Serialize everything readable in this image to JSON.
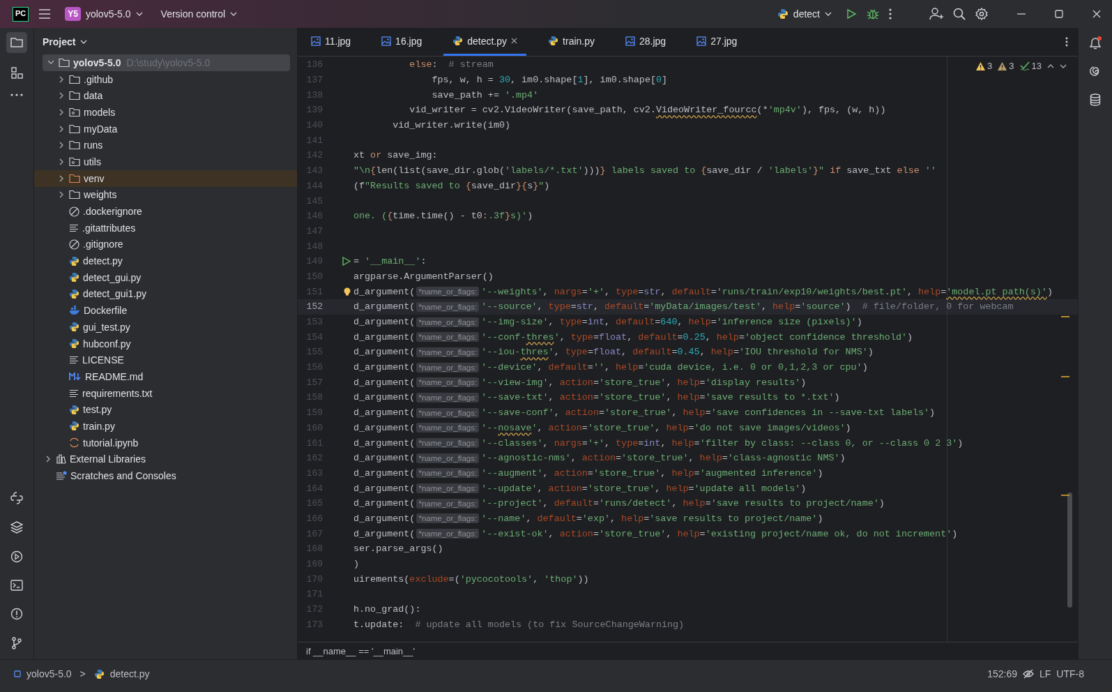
{
  "titlebar": {
    "logo": "PC",
    "project_badge": "Y5",
    "project": "yolov5-5.0",
    "vcs": "Version control",
    "run_config": "detect"
  },
  "project_panel": {
    "title": "Project",
    "tree": [
      {
        "name": "yolov5-5.0",
        "path": "D:\\study\\yolov5-5.0",
        "kind": "folder",
        "expanded": true,
        "selected": true,
        "children": [
          {
            "name": ".github",
            "kind": "folder",
            "expanded": false,
            "selected": false
          },
          {
            "name": "data",
            "kind": "folder",
            "expanded": false,
            "selected": false
          },
          {
            "name": "models",
            "kind": "package",
            "expanded": false,
            "selected": false
          },
          {
            "name": "myData",
            "kind": "folder",
            "expanded": false,
            "selected": false
          },
          {
            "name": "runs",
            "kind": "folder",
            "expanded": false,
            "selected": false
          },
          {
            "name": "utils",
            "kind": "package",
            "expanded": false,
            "selected": false
          },
          {
            "name": "venv",
            "kind": "excluded",
            "expanded": false,
            "selected": false
          },
          {
            "name": "weights",
            "kind": "folder",
            "expanded": false,
            "selected": false
          },
          {
            "name": ".dockerignore",
            "kind": "ignore",
            "selected": false
          },
          {
            "name": ".gitattributes",
            "kind": "text",
            "selected": false
          },
          {
            "name": ".gitignore",
            "kind": "ignore",
            "selected": false
          },
          {
            "name": "detect.py",
            "kind": "python",
            "selected": false
          },
          {
            "name": "detect_gui.py",
            "kind": "python",
            "selected": false
          },
          {
            "name": "detect_gui1.py",
            "kind": "python",
            "selected": false
          },
          {
            "name": "Dockerfile",
            "kind": "docker",
            "selected": false
          },
          {
            "name": "gui_test.py",
            "kind": "python",
            "selected": false
          },
          {
            "name": "hubconf.py",
            "kind": "python",
            "selected": false
          },
          {
            "name": "LICENSE",
            "kind": "text",
            "selected": false
          },
          {
            "name": "README.md",
            "kind": "markdown",
            "selected": false
          },
          {
            "name": "requirements.txt",
            "kind": "text",
            "selected": false
          },
          {
            "name": "test.py",
            "kind": "python",
            "selected": false
          },
          {
            "name": "train.py",
            "kind": "python",
            "selected": false
          },
          {
            "name": "tutorial.ipynb",
            "kind": "notebook",
            "selected": false
          }
        ]
      },
      {
        "name": "External Libraries",
        "kind": "library",
        "expanded": false,
        "selected": false
      },
      {
        "name": "Scratches and Consoles",
        "kind": "scratch",
        "selected": false
      }
    ]
  },
  "tabs": [
    {
      "label": "11.jpg",
      "kind": "image",
      "selected": false
    },
    {
      "label": "16.jpg",
      "kind": "image",
      "selected": false
    },
    {
      "label": "detect.py",
      "kind": "python",
      "selected": true
    },
    {
      "label": "train.py",
      "kind": "python",
      "selected": false
    },
    {
      "label": "28.jpg",
      "kind": "image",
      "selected": false
    },
    {
      "label": "27.jpg",
      "kind": "image",
      "selected": false
    }
  ],
  "inspections": [
    {
      "kind": "warning",
      "count": "3"
    },
    {
      "kind": "weak",
      "count": "3"
    },
    {
      "kind": "typo",
      "count": "13"
    }
  ],
  "code": {
    "lines": [
      {
        "number": "136",
        "current": false,
        "tokens": [
          {
            "kind": "k",
            "text": "          else"
          },
          {
            "kind": "t",
            "text": ":  "
          },
          {
            "kind": "c",
            "text": "# stream"
          }
        ]
      },
      {
        "number": "137",
        "current": false,
        "tokens": [
          {
            "kind": "t",
            "text": "              fps, w, h = "
          },
          {
            "kind": "n",
            "text": "30"
          },
          {
            "kind": "t",
            "text": ", im0.shape["
          },
          {
            "kind": "n",
            "text": "1"
          },
          {
            "kind": "t",
            "text": "], im0.shape["
          },
          {
            "kind": "n",
            "text": "0"
          },
          {
            "kind": "t",
            "text": "]"
          }
        ]
      },
      {
        "number": "138",
        "current": false,
        "tokens": [
          {
            "kind": "t",
            "text": "              save_path += "
          },
          {
            "kind": "s",
            "text": "'.mp4'"
          }
        ]
      },
      {
        "number": "139",
        "current": false,
        "tokens": [
          {
            "kind": "t",
            "text": "          vid_writer = cv2.VideoWriter(save_path, cv2."
          },
          {
            "kind": "w",
            "text": "VideoWriter_fourcc"
          },
          {
            "kind": "t",
            "text": "(*"
          },
          {
            "kind": "s",
            "text": "'mp4v'"
          },
          {
            "kind": "t",
            "text": "), fps, (w, h))"
          }
        ]
      },
      {
        "number": "140",
        "current": false,
        "tokens": [
          {
            "kind": "t",
            "text": "       vid_writer.write(im0)"
          }
        ]
      },
      {
        "number": "141",
        "current": false
      },
      {
        "number": "142",
        "current": false,
        "tokens": [
          {
            "kind": "t",
            "text": "xt "
          },
          {
            "kind": "k",
            "text": "or"
          },
          {
            "kind": "t",
            "text": " save_img:"
          }
        ]
      },
      {
        "number": "143",
        "current": false,
        "tokens": [
          {
            "kind": "s",
            "text": "\"\\n"
          },
          {
            "kind": "f",
            "text": "{"
          },
          {
            "kind": "t",
            "text": "len(list(save_dir.glob("
          },
          {
            "kind": "s",
            "text": "'labels/*.txt'"
          },
          {
            "kind": "t",
            "text": ")))"
          },
          {
            "kind": "f",
            "text": "}"
          },
          {
            "kind": "s",
            "text": " labels saved to "
          },
          {
            "kind": "f",
            "text": "{"
          },
          {
            "kind": "t",
            "text": "save_dir / "
          },
          {
            "kind": "s",
            "text": "'labels'"
          },
          {
            "kind": "f",
            "text": "}"
          },
          {
            "kind": "s",
            "text": "\" "
          },
          {
            "kind": "k",
            "text": "if"
          },
          {
            "kind": "t",
            "text": " save_txt "
          },
          {
            "kind": "k",
            "text": "else"
          },
          {
            "kind": "s",
            "text": " ''"
          }
        ]
      },
      {
        "number": "144",
        "current": false,
        "tokens": [
          {
            "kind": "t",
            "text": "(f"
          },
          {
            "kind": "s",
            "text": "\"Results saved to "
          },
          {
            "kind": "f",
            "text": "{"
          },
          {
            "kind": "t",
            "text": "save_dir"
          },
          {
            "kind": "f",
            "text": "}{"
          },
          {
            "kind": "t",
            "text": "s"
          },
          {
            "kind": "f",
            "text": "}"
          },
          {
            "kind": "s",
            "text": "\""
          },
          {
            "kind": "t",
            "text": ")"
          }
        ]
      },
      {
        "number": "145",
        "current": false
      },
      {
        "number": "146",
        "current": false,
        "tokens": [
          {
            "kind": "s",
            "text": "one. ("
          },
          {
            "kind": "f",
            "text": "{"
          },
          {
            "kind": "t",
            "text": "time.time() - t0"
          },
          {
            "kind": "f",
            "text": ":"
          },
          {
            "kind": "s",
            "text": ".3f"
          },
          {
            "kind": "f",
            "text": "}"
          },
          {
            "kind": "s",
            "text": "s)'"
          },
          {
            "kind": "t",
            "text": ")"
          }
        ]
      },
      {
        "number": "147",
        "current": false
      },
      {
        "number": "148",
        "current": false
      },
      {
        "number": "149",
        "current": false,
        "kind": "run",
        "tokens": [
          {
            "kind": "t",
            "text": "= "
          },
          {
            "kind": "s",
            "text": "'__main__'"
          },
          {
            "kind": "t",
            "text": ":"
          }
        ]
      },
      {
        "number": "150",
        "current": false,
        "tokens": [
          {
            "kind": "t",
            "text": "argparse.ArgumentParser()"
          }
        ]
      },
      {
        "number": "151",
        "current": false,
        "kind": "bulb",
        "tokens": [
          {
            "kind": "t",
            "text": "d_argument("
          },
          {
            "kind": "h",
            "text": "*name_or_flags:"
          },
          {
            "kind": "s",
            "text": "'--weights'"
          },
          {
            "kind": "t",
            "text": ", "
          },
          {
            "kind": "a",
            "text": "nargs"
          },
          {
            "kind": "t",
            "text": "="
          },
          {
            "kind": "s",
            "text": "'+'"
          },
          {
            "kind": "t",
            "text": ", "
          },
          {
            "kind": "a",
            "text": "type"
          },
          {
            "kind": "t",
            "text": "="
          },
          {
            "kind": "b",
            "text": "str"
          },
          {
            "kind": "t",
            "text": ", "
          },
          {
            "kind": "a",
            "text": "default"
          },
          {
            "kind": "t",
            "text": "="
          },
          {
            "kind": "s",
            "text": "'runs/train/exp10/weights/best.pt'"
          },
          {
            "kind": "t",
            "text": ", "
          },
          {
            "kind": "a",
            "text": "help"
          },
          {
            "kind": "t",
            "text": "="
          },
          {
            "kind": "x",
            "text": "'model.pt path(s)'"
          },
          {
            "kind": "t",
            "text": ")"
          }
        ]
      },
      {
        "number": "152",
        "current": true,
        "tokens": [
          {
            "kind": "t",
            "text": "d_argument("
          },
          {
            "kind": "h",
            "text": "*name_or_flags:"
          },
          {
            "kind": "s",
            "text": "'--source'"
          },
          {
            "kind": "t",
            "text": ", "
          },
          {
            "kind": "a",
            "text": "type"
          },
          {
            "kind": "t",
            "text": "="
          },
          {
            "kind": "b",
            "text": "str"
          },
          {
            "kind": "t",
            "text": ", "
          },
          {
            "kind": "a",
            "text": "default"
          },
          {
            "kind": "t",
            "text": "="
          },
          {
            "kind": "s",
            "text": "'myData/images/test'"
          },
          {
            "kind": "t",
            "text": ", "
          },
          {
            "kind": "a",
            "text": "help"
          },
          {
            "kind": "t",
            "text": "="
          },
          {
            "kind": "s",
            "text": "'source'"
          },
          {
            "kind": "t",
            "text": ")  "
          },
          {
            "kind": "c",
            "text": "# file/folder, 0 for webcam"
          }
        ]
      },
      {
        "number": "153",
        "current": false,
        "tokens": [
          {
            "kind": "t",
            "text": "d_argument("
          },
          {
            "kind": "h",
            "text": "*name_or_flags:"
          },
          {
            "kind": "s",
            "text": "'--img-size'"
          },
          {
            "kind": "t",
            "text": ", "
          },
          {
            "kind": "a",
            "text": "type"
          },
          {
            "kind": "t",
            "text": "="
          },
          {
            "kind": "b",
            "text": "int"
          },
          {
            "kind": "t",
            "text": ", "
          },
          {
            "kind": "a",
            "text": "default"
          },
          {
            "kind": "t",
            "text": "="
          },
          {
            "kind": "n",
            "text": "640"
          },
          {
            "kind": "t",
            "text": ", "
          },
          {
            "kind": "a",
            "text": "help"
          },
          {
            "kind": "t",
            "text": "="
          },
          {
            "kind": "s",
            "text": "'inference size (pixels)'"
          },
          {
            "kind": "t",
            "text": ")"
          }
        ]
      },
      {
        "number": "154",
        "current": false,
        "tokens": [
          {
            "kind": "t",
            "text": "d_argument("
          },
          {
            "kind": "h",
            "text": "*name_or_flags:"
          },
          {
            "kind": "s",
            "text": "'--conf-"
          },
          {
            "kind": "x",
            "text": "thres"
          },
          {
            "kind": "s",
            "text": "'"
          },
          {
            "kind": "t",
            "text": ", "
          },
          {
            "kind": "a",
            "text": "type"
          },
          {
            "kind": "t",
            "text": "="
          },
          {
            "kind": "b",
            "text": "float"
          },
          {
            "kind": "t",
            "text": ", "
          },
          {
            "kind": "a",
            "text": "default"
          },
          {
            "kind": "t",
            "text": "="
          },
          {
            "kind": "n",
            "text": "0.25"
          },
          {
            "kind": "t",
            "text": ", "
          },
          {
            "kind": "a",
            "text": "help"
          },
          {
            "kind": "t",
            "text": "="
          },
          {
            "kind": "s",
            "text": "'object confidence threshold'"
          },
          {
            "kind": "t",
            "text": ")"
          }
        ]
      },
      {
        "number": "155",
        "current": false,
        "tokens": [
          {
            "kind": "t",
            "text": "d_argument("
          },
          {
            "kind": "h",
            "text": "*name_or_flags:"
          },
          {
            "kind": "s",
            "text": "'--iou-"
          },
          {
            "kind": "x",
            "text": "thres"
          },
          {
            "kind": "s",
            "text": "'"
          },
          {
            "kind": "t",
            "text": ", "
          },
          {
            "kind": "a",
            "text": "type"
          },
          {
            "kind": "t",
            "text": "="
          },
          {
            "kind": "b",
            "text": "float"
          },
          {
            "kind": "t",
            "text": ", "
          },
          {
            "kind": "a",
            "text": "default"
          },
          {
            "kind": "t",
            "text": "="
          },
          {
            "kind": "n",
            "text": "0.45"
          },
          {
            "kind": "t",
            "text": ", "
          },
          {
            "kind": "a",
            "text": "help"
          },
          {
            "kind": "t",
            "text": "="
          },
          {
            "kind": "s",
            "text": "'IOU threshold for NMS'"
          },
          {
            "kind": "t",
            "text": ")"
          }
        ]
      },
      {
        "number": "156",
        "current": false,
        "tokens": [
          {
            "kind": "t",
            "text": "d_argument("
          },
          {
            "kind": "h",
            "text": "*name_or_flags:"
          },
          {
            "kind": "s",
            "text": "'--device'"
          },
          {
            "kind": "t",
            "text": ", "
          },
          {
            "kind": "a",
            "text": "default"
          },
          {
            "kind": "t",
            "text": "="
          },
          {
            "kind": "s",
            "text": "''"
          },
          {
            "kind": "t",
            "text": ", "
          },
          {
            "kind": "a",
            "text": "help"
          },
          {
            "kind": "t",
            "text": "="
          },
          {
            "kind": "s",
            "text": "'cuda device, i.e. 0 or 0,1,2,3 or cpu'"
          },
          {
            "kind": "t",
            "text": ")"
          }
        ]
      },
      {
        "number": "157",
        "current": false,
        "tokens": [
          {
            "kind": "t",
            "text": "d_argument("
          },
          {
            "kind": "h",
            "text": "*name_or_flags:"
          },
          {
            "kind": "s",
            "text": "'--view-img'"
          },
          {
            "kind": "t",
            "text": ", "
          },
          {
            "kind": "a",
            "text": "action"
          },
          {
            "kind": "t",
            "text": "="
          },
          {
            "kind": "s",
            "text": "'store_true'"
          },
          {
            "kind": "t",
            "text": ", "
          },
          {
            "kind": "a",
            "text": "help"
          },
          {
            "kind": "t",
            "text": "="
          },
          {
            "kind": "s",
            "text": "'display results'"
          },
          {
            "kind": "t",
            "text": ")"
          }
        ]
      },
      {
        "number": "158",
        "current": false,
        "tokens": [
          {
            "kind": "t",
            "text": "d_argument("
          },
          {
            "kind": "h",
            "text": "*name_or_flags:"
          },
          {
            "kind": "s",
            "text": "'--save-txt'"
          },
          {
            "kind": "t",
            "text": ", "
          },
          {
            "kind": "a",
            "text": "action"
          },
          {
            "kind": "t",
            "text": "="
          },
          {
            "kind": "s",
            "text": "'store_true'"
          },
          {
            "kind": "t",
            "text": ", "
          },
          {
            "kind": "a",
            "text": "help"
          },
          {
            "kind": "t",
            "text": "="
          },
          {
            "kind": "s",
            "text": "'save results to *.txt'"
          },
          {
            "kind": "t",
            "text": ")"
          }
        ]
      },
      {
        "number": "159",
        "current": false,
        "tokens": [
          {
            "kind": "t",
            "text": "d_argument("
          },
          {
            "kind": "h",
            "text": "*name_or_flags:"
          },
          {
            "kind": "s",
            "text": "'--save-conf'"
          },
          {
            "kind": "t",
            "text": ", "
          },
          {
            "kind": "a",
            "text": "action"
          },
          {
            "kind": "t",
            "text": "="
          },
          {
            "kind": "s",
            "text": "'store_true'"
          },
          {
            "kind": "t",
            "text": ", "
          },
          {
            "kind": "a",
            "text": "help"
          },
          {
            "kind": "t",
            "text": "="
          },
          {
            "kind": "s",
            "text": "'save confidences in --save-txt labels'"
          },
          {
            "kind": "t",
            "text": ")"
          }
        ]
      },
      {
        "number": "160",
        "current": false,
        "tokens": [
          {
            "kind": "t",
            "text": "d_argument("
          },
          {
            "kind": "h",
            "text": "*name_or_flags:"
          },
          {
            "kind": "s",
            "text": "'--"
          },
          {
            "kind": "x",
            "text": "nosave"
          },
          {
            "kind": "s",
            "text": "'"
          },
          {
            "kind": "t",
            "text": ", "
          },
          {
            "kind": "a",
            "text": "action"
          },
          {
            "kind": "t",
            "text": "="
          },
          {
            "kind": "s",
            "text": "'store_true'"
          },
          {
            "kind": "t",
            "text": ", "
          },
          {
            "kind": "a",
            "text": "help"
          },
          {
            "kind": "t",
            "text": "="
          },
          {
            "kind": "s",
            "text": "'do not save images/videos'"
          },
          {
            "kind": "t",
            "text": ")"
          }
        ]
      },
      {
        "number": "161",
        "current": false,
        "tokens": [
          {
            "kind": "t",
            "text": "d_argument("
          },
          {
            "kind": "h",
            "text": "*name_or_flags:"
          },
          {
            "kind": "s",
            "text": "'--classes'"
          },
          {
            "kind": "t",
            "text": ", "
          },
          {
            "kind": "a",
            "text": "nargs"
          },
          {
            "kind": "t",
            "text": "="
          },
          {
            "kind": "s",
            "text": "'+'"
          },
          {
            "kind": "t",
            "text": ", "
          },
          {
            "kind": "a",
            "text": "type"
          },
          {
            "kind": "t",
            "text": "="
          },
          {
            "kind": "b",
            "text": "int"
          },
          {
            "kind": "t",
            "text": ", "
          },
          {
            "kind": "a",
            "text": "help"
          },
          {
            "kind": "t",
            "text": "="
          },
          {
            "kind": "s",
            "text": "'filter by class: --class 0, or --class 0 2 3'"
          },
          {
            "kind": "t",
            "text": ")"
          }
        ]
      },
      {
        "number": "162",
        "current": false,
        "tokens": [
          {
            "kind": "t",
            "text": "d_argument("
          },
          {
            "kind": "h",
            "text": "*name_or_flags:"
          },
          {
            "kind": "s",
            "text": "'--agnostic-nms'"
          },
          {
            "kind": "t",
            "text": ", "
          },
          {
            "kind": "a",
            "text": "action"
          },
          {
            "kind": "t",
            "text": "="
          },
          {
            "kind": "s",
            "text": "'store_true'"
          },
          {
            "kind": "t",
            "text": ", "
          },
          {
            "kind": "a",
            "text": "help"
          },
          {
            "kind": "t",
            "text": "="
          },
          {
            "kind": "s",
            "text": "'class-agnostic NMS'"
          },
          {
            "kind": "t",
            "text": ")"
          }
        ]
      },
      {
        "number": "163",
        "current": false,
        "tokens": [
          {
            "kind": "t",
            "text": "d_argument("
          },
          {
            "kind": "h",
            "text": "*name_or_flags:"
          },
          {
            "kind": "s",
            "text": "'--augment'"
          },
          {
            "kind": "t",
            "text": ", "
          },
          {
            "kind": "a",
            "text": "action"
          },
          {
            "kind": "t",
            "text": "="
          },
          {
            "kind": "s",
            "text": "'store_true'"
          },
          {
            "kind": "t",
            "text": ", "
          },
          {
            "kind": "a",
            "text": "help"
          },
          {
            "kind": "t",
            "text": "="
          },
          {
            "kind": "s",
            "text": "'augmented inference'"
          },
          {
            "kind": "t",
            "text": ")"
          }
        ]
      },
      {
        "number": "164",
        "current": false,
        "tokens": [
          {
            "kind": "t",
            "text": "d_argument("
          },
          {
            "kind": "h",
            "text": "*name_or_flags:"
          },
          {
            "kind": "s",
            "text": "'--update'"
          },
          {
            "kind": "t",
            "text": ", "
          },
          {
            "kind": "a",
            "text": "action"
          },
          {
            "kind": "t",
            "text": "="
          },
          {
            "kind": "s",
            "text": "'store_true'"
          },
          {
            "kind": "t",
            "text": ", "
          },
          {
            "kind": "a",
            "text": "help"
          },
          {
            "kind": "t",
            "text": "="
          },
          {
            "kind": "s",
            "text": "'update all models'"
          },
          {
            "kind": "t",
            "text": ")"
          }
        ]
      },
      {
        "number": "165",
        "current": false,
        "tokens": [
          {
            "kind": "t",
            "text": "d_argument("
          },
          {
            "kind": "h",
            "text": "*name_or_flags:"
          },
          {
            "kind": "s",
            "text": "'--project'"
          },
          {
            "kind": "t",
            "text": ", "
          },
          {
            "kind": "a",
            "text": "default"
          },
          {
            "kind": "t",
            "text": "="
          },
          {
            "kind": "s",
            "text": "'runs/detect'"
          },
          {
            "kind": "t",
            "text": ", "
          },
          {
            "kind": "a",
            "text": "help"
          },
          {
            "kind": "t",
            "text": "="
          },
          {
            "kind": "s",
            "text": "'save results to project/name'"
          },
          {
            "kind": "t",
            "text": ")"
          }
        ]
      },
      {
        "number": "166",
        "current": false,
        "tokens": [
          {
            "kind": "t",
            "text": "d_argument("
          },
          {
            "kind": "h",
            "text": "*name_or_flags:"
          },
          {
            "kind": "s",
            "text": "'--name'"
          },
          {
            "kind": "t",
            "text": ", "
          },
          {
            "kind": "a",
            "text": "default"
          },
          {
            "kind": "t",
            "text": "="
          },
          {
            "kind": "s",
            "text": "'exp'"
          },
          {
            "kind": "t",
            "text": ", "
          },
          {
            "kind": "a",
            "text": "help"
          },
          {
            "kind": "t",
            "text": "="
          },
          {
            "kind": "s",
            "text": "'save results to project/name'"
          },
          {
            "kind": "t",
            "text": ")"
          }
        ]
      },
      {
        "number": "167",
        "current": false,
        "tokens": [
          {
            "kind": "t",
            "text": "d_argument("
          },
          {
            "kind": "h",
            "text": "*name_or_flags:"
          },
          {
            "kind": "s",
            "text": "'--exist-ok'"
          },
          {
            "kind": "t",
            "text": ", "
          },
          {
            "kind": "a",
            "text": "action"
          },
          {
            "kind": "t",
            "text": "="
          },
          {
            "kind": "s",
            "text": "'store_true'"
          },
          {
            "kind": "t",
            "text": ", "
          },
          {
            "kind": "a",
            "text": "help"
          },
          {
            "kind": "t",
            "text": "="
          },
          {
            "kind": "s",
            "text": "'existing project/name ok, do not increment'"
          },
          {
            "kind": "t",
            "text": ")"
          }
        ]
      },
      {
        "number": "168",
        "current": false,
        "tokens": [
          {
            "kind": "t",
            "text": "ser.parse_args()"
          }
        ]
      },
      {
        "number": "169",
        "current": false,
        "tokens": [
          {
            "kind": "t",
            "text": ")"
          }
        ]
      },
      {
        "number": "170",
        "current": false,
        "tokens": [
          {
            "kind": "t",
            "text": "uirements("
          },
          {
            "kind": "a",
            "text": "exclude"
          },
          {
            "kind": "t",
            "text": "=("
          },
          {
            "kind": "s",
            "text": "'pycocotools'"
          },
          {
            "kind": "t",
            "text": ", "
          },
          {
            "kind": "s",
            "text": "'thop'"
          },
          {
            "kind": "t",
            "text": "))"
          }
        ]
      },
      {
        "number": "171",
        "current": false
      },
      {
        "number": "172",
        "current": false,
        "tokens": [
          {
            "kind": "t",
            "text": "h.no_grad():"
          }
        ]
      },
      {
        "number": "173",
        "current": false,
        "tokens": [
          {
            "kind": "t",
            "text": "t.update:  "
          },
          {
            "kind": "c",
            "text": "# update all models (to fix SourceChangeWarning)"
          }
        ]
      }
    ]
  },
  "breadcrumb": "if __name__ == '__main__'",
  "status_bar": {
    "path": [
      "yolov5-5.0",
      "detect.py"
    ],
    "separator": ">",
    "position": "152:69",
    "line_ending": "LF",
    "encoding": "UTF-8"
  }
}
